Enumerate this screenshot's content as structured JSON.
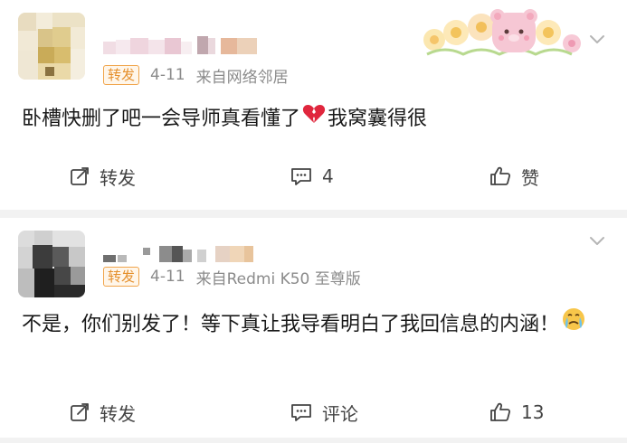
{
  "posts": [
    {
      "badge": "转发",
      "date": "4-11",
      "source": "来自网络邻居",
      "text_before": "卧槽快删了吧一会导师真看懂了",
      "emoji_1": "broken-heart-icon",
      "text_after": "我窝囊得很",
      "actions": {
        "repost": "转发",
        "comment": "4",
        "like": "赞"
      }
    },
    {
      "badge": "转发",
      "date": "4-11",
      "source": "来自Redmi K50 至尊版",
      "text_before": "不是，你们别发了！等下真让我导看明白了我回信息的内涵！",
      "emoji_1": "crying-face-icon",
      "actions": {
        "repost": "转发",
        "comment": "评论",
        "like": "13"
      }
    }
  ],
  "colors": {
    "badge_border": "#f0a44a",
    "badge_text": "#e5902d",
    "meta_text": "#8b8b8b",
    "content_text": "#1a1a1a",
    "divider": "#f2f2f2"
  }
}
